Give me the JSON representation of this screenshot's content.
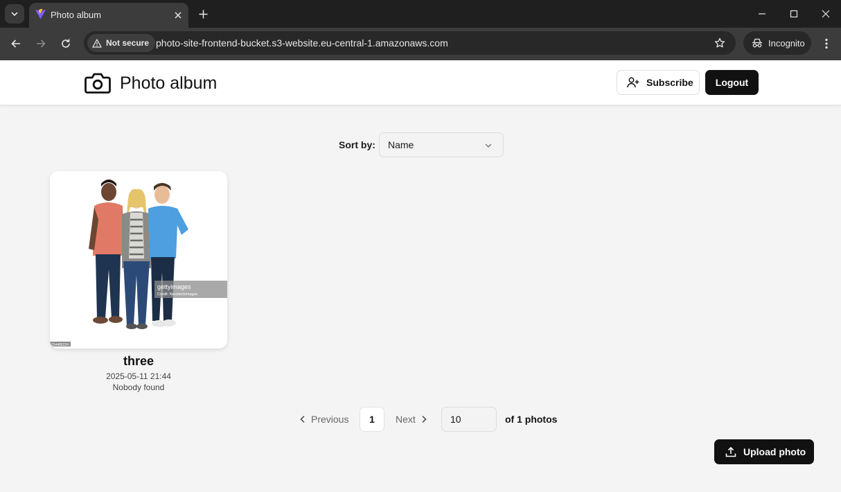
{
  "browser": {
    "tab_title": "Photo album",
    "security_label": "Not secure",
    "url": "photo-site-frontend-bucket.s3-website.eu-central-1.amazonaws.com",
    "profile_label": "Incognito"
  },
  "header": {
    "title": "Photo album",
    "subscribe_label": "Subscribe",
    "logout_label": "Logout"
  },
  "sort": {
    "label": "Sort by:",
    "selected": "Name"
  },
  "photos": [
    {
      "name": "three",
      "date": "2025-05-11 21:44",
      "faces": "Nobody found",
      "watermark": "gettyimages",
      "watermark_credit": "Credit: Neustockimages",
      "image_id": "154486224"
    }
  ],
  "pagination": {
    "previous_label": "Previous",
    "current_page": "1",
    "next_label": "Next",
    "per_page": "10",
    "total_label": "of 1 photos"
  },
  "upload_label": "Upload photo",
  "colors": {
    "primary": "#111111",
    "background": "#f4f4f4",
    "browser_frame": "#1f1f1f"
  }
}
